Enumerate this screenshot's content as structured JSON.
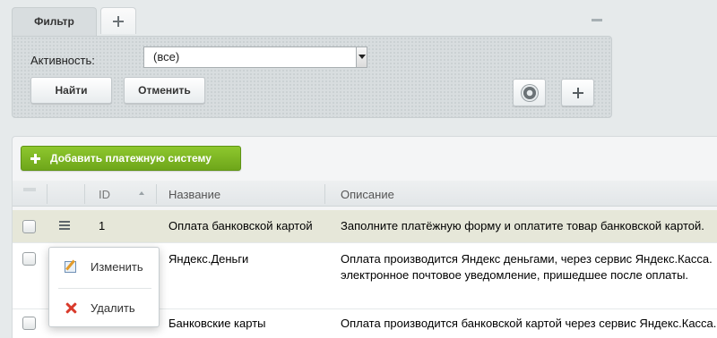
{
  "filter": {
    "tab_label": "Фильтр",
    "activity_label": "Активность:",
    "activity_value": "(все)",
    "find_label": "Найти",
    "cancel_label": "Отменить"
  },
  "toolbar": {
    "add_payment_system_label": "Добавить платежную систему"
  },
  "table": {
    "columns": [
      "ID",
      "Название",
      "Описание"
    ],
    "rows": [
      {
        "id": "1",
        "name": "Оплата банковской картой",
        "description": "Заполните платёжную форму и оплатите товар банковской картой."
      },
      {
        "id": "",
        "name": "Яндекс.Деньги",
        "description": "Оплата производится Яндекс деньгами, через сервис Яндекс.Касса.",
        "description_line2": "электронное почтовое уведомление, пришедшее после оплаты."
      },
      {
        "id": "",
        "name": "Банковские карты",
        "description": "Оплата производится банковской картой через сервис Яндекс.Касса."
      }
    ]
  },
  "context_menu": {
    "edit_label": "Изменить",
    "delete_label": "Удалить"
  },
  "colors": {
    "accent_green": "#7bb624",
    "selected_row": "#e6e7d9",
    "delete_red": "#d93a2b"
  }
}
